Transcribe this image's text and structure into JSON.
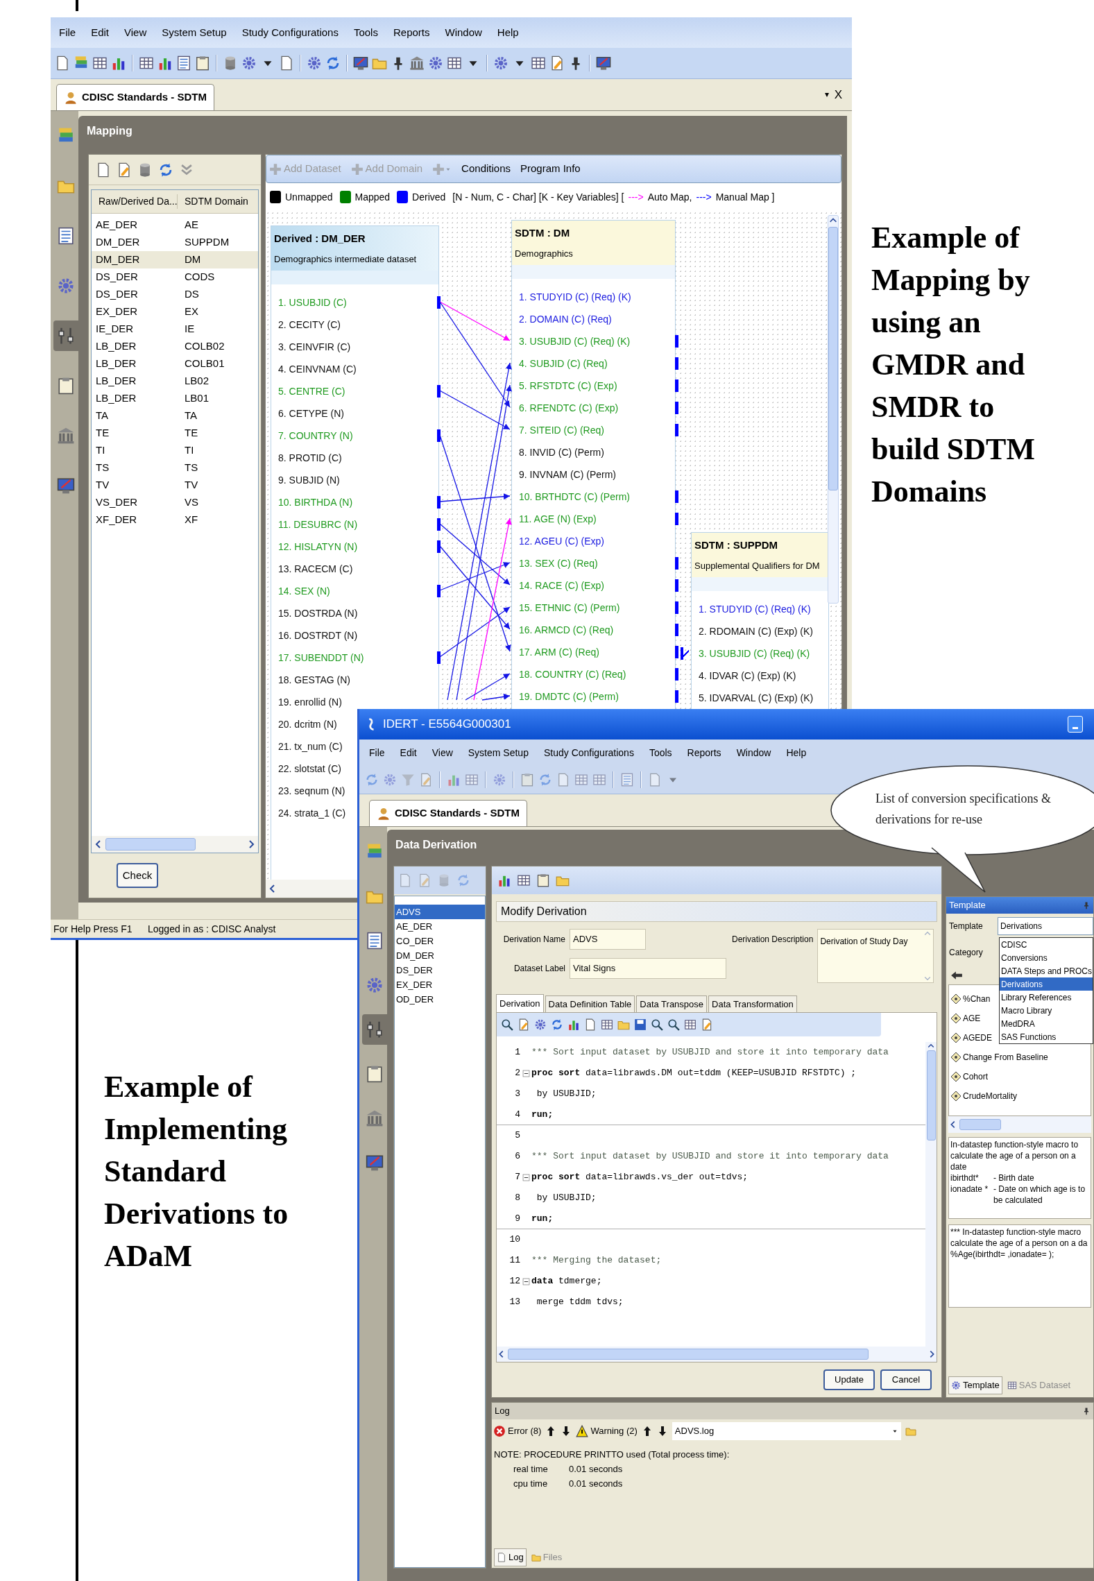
{
  "top_window": {
    "menu": [
      "File",
      "Edit",
      "View",
      "System Setup",
      "Study Configurations",
      "Tools",
      "Reports",
      "Window",
      "Help"
    ],
    "tab": {
      "label": "CDISC Standards - SDTM",
      "selected": true
    },
    "tab_controls": [
      {
        "kind": "menu",
        "label": "▾"
      },
      {
        "kind": "close",
        "label": "X"
      }
    ],
    "sidebar_items": [
      {
        "selected": false
      },
      {
        "selected": false
      },
      {
        "selected": false
      },
      {
        "selected": false
      },
      {
        "selected": true
      },
      {
        "selected": false
      },
      {
        "selected": false
      },
      {
        "selected": false
      }
    ],
    "panel_title": "Mapping",
    "dataset_table": {
      "columns": [
        "Raw/Derived Da...",
        "SDTM Domain"
      ],
      "rows": [
        {
          "dataset": "AE_DER",
          "domain": "AE",
          "selected": false
        },
        {
          "dataset": "DM_DER",
          "domain": "SUPPDM",
          "selected": false
        },
        {
          "dataset": "DM_DER",
          "domain": "DM",
          "selected": true
        },
        {
          "dataset": "DS_DER",
          "domain": "CODS",
          "selected": false
        },
        {
          "dataset": "DS_DER",
          "domain": "DS",
          "selected": false
        },
        {
          "dataset": "EX_DER",
          "domain": "EX",
          "selected": false
        },
        {
          "dataset": "IE_DER",
          "domain": "IE",
          "selected": false
        },
        {
          "dataset": "LB_DER",
          "domain": "COLB02",
          "selected": false
        },
        {
          "dataset": "LB_DER",
          "domain": "COLB01",
          "selected": false
        },
        {
          "dataset": "LB_DER",
          "domain": "LB02",
          "selected": false
        },
        {
          "dataset": "LB_DER",
          "domain": "LB01",
          "selected": false
        },
        {
          "dataset": "TA",
          "domain": "TA",
          "selected": false
        },
        {
          "dataset": "TE",
          "domain": "TE",
          "selected": false
        },
        {
          "dataset": "TI",
          "domain": "TI",
          "selected": false
        },
        {
          "dataset": "TS",
          "domain": "TS",
          "selected": false
        },
        {
          "dataset": "TV",
          "domain": "TV",
          "selected": false
        },
        {
          "dataset": "VS_DER",
          "domain": "VS",
          "selected": false
        },
        {
          "dataset": "XF_DER",
          "domain": "XF",
          "selected": false
        }
      ]
    },
    "check_button": "Check",
    "toolbar": [
      {
        "kind": "add",
        "label": "Add Dataset",
        "disabled": true
      },
      {
        "kind": "add",
        "label": "Add Domain",
        "disabled": true
      },
      {
        "kind": "add_menu",
        "disabled": true
      },
      {
        "kind": "text",
        "label": "Conditions",
        "disabled": false
      },
      {
        "kind": "text",
        "label": "Program Info",
        "disabled": false
      }
    ],
    "legend": [
      {
        "label": "Unmapped",
        "color": "#000000"
      },
      {
        "label": "Mapped",
        "color": "#008000"
      },
      {
        "label": "Derived",
        "color": "#0000ff"
      }
    ],
    "legend_note": "[N - Num, C - Char] [K - Key Variables] [",
    "map_types": [
      {
        "arrow": "--->",
        "label": "Auto Map,",
        "color": "#ff00ff"
      },
      {
        "arrow": "--->",
        "label": "Manual Map ]",
        "color": "#0000ff"
      }
    ],
    "datasets": [
      {
        "kind": "derived",
        "title": "Derived : DM_DER",
        "subtitle": "Demographics intermediate dataset",
        "variables": [
          {
            "label": "1. USUBJID (C)",
            "color": "#1f9a1f",
            "mapped": true
          },
          {
            "label": "2. CECITY (C)",
            "color": "#111111",
            "mapped": false
          },
          {
            "label": "3. CEINVFIR (C)",
            "color": "#111111",
            "mapped": false
          },
          {
            "label": "4. CEINVNAM (C)",
            "color": "#111111",
            "mapped": false
          },
          {
            "label": "5. CENTRE (C)",
            "color": "#1f9a1f",
            "mapped": true
          },
          {
            "label": "6. CETYPE (N)",
            "color": "#111111",
            "mapped": false
          },
          {
            "label": "7. COUNTRY (N)",
            "color": "#1f9a1f",
            "mapped": true
          },
          {
            "label": "8. PROTID (C)",
            "color": "#111111",
            "mapped": false
          },
          {
            "label": "9. SUBJID (N)",
            "color": "#111111",
            "mapped": false
          },
          {
            "label": "10. BIRTHDA (N)",
            "color": "#1f9a1f",
            "mapped": true
          },
          {
            "label": "11. DESUBRC (N)",
            "color": "#1f9a1f",
            "mapped": true
          },
          {
            "label": "12. HISLATYN (N)",
            "color": "#1f9a1f",
            "mapped": true
          },
          {
            "label": "13. RACECM (C)",
            "color": "#111111",
            "mapped": false
          },
          {
            "label": "14. SEX (N)",
            "color": "#1f9a1f",
            "mapped": true
          },
          {
            "label": "15. DOSTRDA (N)",
            "color": "#111111",
            "mapped": false
          },
          {
            "label": "16. DOSTRDT (N)",
            "color": "#111111",
            "mapped": false
          },
          {
            "label": "17. SUBENDDT (N)",
            "color": "#1f9a1f",
            "mapped": true
          },
          {
            "label": "18. GESTAG (N)",
            "color": "#111111",
            "mapped": false
          },
          {
            "label": "19. enrollid (N)",
            "color": "#111111",
            "mapped": false
          },
          {
            "label": "20. dcritm (N)",
            "color": "#111111",
            "mapped": false
          },
          {
            "label": "21. tx_num (C)",
            "color": "#111111",
            "mapped": false
          },
          {
            "label": "22. slotstat (C)",
            "color": "#111111",
            "mapped": false
          },
          {
            "label": "23. seqnum (N)",
            "color": "#111111",
            "mapped": false
          },
          {
            "label": "24. strata_1 (C)",
            "color": "#111111",
            "mapped": false
          }
        ]
      },
      {
        "kind": "sdtm",
        "title": "SDTM : DM",
        "subtitle": "Demographics",
        "variables": [
          {
            "label": "1. STUDYID (C) (Req) (K)",
            "color": "#1a1ae0",
            "mapped": false
          },
          {
            "label": "2. DOMAIN (C) (Req)",
            "color": "#1a1ae0",
            "mapped": false
          },
          {
            "label": "3. USUBJID (C) (Req) (K)",
            "color": "#1f9a1f",
            "mapped": true
          },
          {
            "label": "4. SUBJID (C) (Req)",
            "color": "#1f9a1f",
            "mapped": true
          },
          {
            "label": "5. RFSTDTC (C) (Exp)",
            "color": "#1f9a1f",
            "mapped": true
          },
          {
            "label": "6. RFENDTC (C) (Exp)",
            "color": "#1f9a1f",
            "mapped": true
          },
          {
            "label": "7. SITEID (C) (Req)",
            "color": "#1f9a1f",
            "mapped": true
          },
          {
            "label": "8. INVID (C) (Perm)",
            "color": "#111111",
            "mapped": false
          },
          {
            "label": "9. INVNAM (C) (Perm)",
            "color": "#111111",
            "mapped": false
          },
          {
            "label": "10. BRTHDTC (C) (Perm)",
            "color": "#1f9a1f",
            "mapped": true
          },
          {
            "label": "11. AGE (N) (Exp)",
            "color": "#1f9a1f",
            "mapped": true
          },
          {
            "label": "12. AGEU (C) (Exp)",
            "color": "#1a1ae0",
            "mapped": false
          },
          {
            "label": "13. SEX (C) (Req)",
            "color": "#1f9a1f",
            "mapped": true
          },
          {
            "label": "14. RACE (C) (Exp)",
            "color": "#1f9a1f",
            "mapped": true
          },
          {
            "label": "15. ETHNIC (C) (Perm)",
            "color": "#1f9a1f",
            "mapped": true
          },
          {
            "label": "16. ARMCD (C) (Req)",
            "color": "#1f9a1f",
            "mapped": true
          },
          {
            "label": "17. ARM (C) (Req)",
            "color": "#1f9a1f",
            "mapped": true
          },
          {
            "label": "18. COUNTRY (C) (Req)",
            "color": "#1f9a1f",
            "mapped": true
          },
          {
            "label": "19. DMDTC (C) (Perm)",
            "color": "#1f9a1f",
            "mapped": true
          }
        ]
      },
      {
        "kind": "sdtm_supp",
        "title": "SDTM : SUPPDM",
        "subtitle": "Supplemental Qualifiers for DM",
        "variables": [
          {
            "label": "1. STUDYID (C) (Req) (K)",
            "color": "#1a1ae0",
            "mapped": false
          },
          {
            "label": "2. RDOMAIN (C) (Exp) (K)",
            "color": "#111111",
            "mapped": false
          },
          {
            "label": "3. USUBJID (C) (Req) (K)",
            "color": "#1f9a1f",
            "mapped": true
          },
          {
            "label": "4. IDVAR (C) (Exp) (K)",
            "color": "#111111",
            "mapped": false
          },
          {
            "label": "5. IDVARVAL (C) (Exp) (K)",
            "color": "#111111",
            "mapped": false
          }
        ]
      }
    ],
    "status_bar": [
      "For Help Press F1",
      "Logged in as : CDISC Analyst"
    ]
  },
  "bottom_window": {
    "title": "IDERT - E5564G000301",
    "menu": [
      "File",
      "Edit",
      "View",
      "System Setup",
      "Study Configurations",
      "Tools",
      "Reports",
      "Window",
      "Help"
    ],
    "tab": {
      "label": "CDISC Standards - SDTM",
      "selected": true
    },
    "sidebar_items": [
      {
        "selected": false
      },
      {
        "selected": false
      },
      {
        "selected": false
      },
      {
        "selected": false
      },
      {
        "selected": true
      },
      {
        "selected": false
      },
      {
        "selected": false
      },
      {
        "selected": false
      }
    ],
    "panel_title": "Data Derivation",
    "callout": "List of conversion specifications & derivations for re-use",
    "derivations": [
      {
        "label": "ADVS",
        "selected": true
      },
      {
        "label": "AE_DER",
        "selected": false
      },
      {
        "label": "CO_DER",
        "selected": false
      },
      {
        "label": "DM_DER",
        "selected": false
      },
      {
        "label": "DS_DER",
        "selected": false
      },
      {
        "label": "EX_DER",
        "selected": false
      },
      {
        "label": "OD_DER",
        "selected": false
      }
    ],
    "form_title": "Modify Derivation",
    "fields": [
      {
        "label": "Derivation Name",
        "value": "ADVS"
      },
      {
        "label": "Dataset Label",
        "value": "Vital Signs"
      }
    ],
    "description": {
      "label": "Derivation Description",
      "value": "Derivation of Study Day"
    },
    "editor_tabs": [
      {
        "label": "Derivation",
        "selected": true
      },
      {
        "label": "Data Definition Table",
        "selected": false
      },
      {
        "label": "Data Transpose",
        "selected": false
      },
      {
        "label": "Data Transformation",
        "selected": false
      }
    ],
    "code_lines": [
      {
        "num": "1",
        "kind": "comment",
        "fold": false,
        "text": "*** Sort input dataset by USUBJID and store it into temporary data"
      },
      {
        "num": "2",
        "kind": "code",
        "fold": true,
        "text": "**proc sort** data=librawds.DM out=tddm (KEEP=USUBJID RFSTDTC) ;"
      },
      {
        "num": "3",
        "kind": "code",
        "fold": false,
        "text": " by USUBJID;"
      },
      {
        "num": "4",
        "kind": "block_end",
        "fold": false,
        "text": "run;"
      },
      {
        "num": "5",
        "kind": "blank",
        "fold": false
      },
      {
        "num": "6",
        "kind": "comment",
        "fold": false,
        "text": "*** Sort input dataset by USUBJID and store it into temporary data"
      },
      {
        "num": "7",
        "kind": "code",
        "fold": true,
        "text": "**proc sort** data=librawds.vs_der out=tdvs;"
      },
      {
        "num": "8",
        "kind": "code",
        "fold": false,
        "text": " by USUBJID;"
      },
      {
        "num": "9",
        "kind": "block_end",
        "fold": false,
        "text": "run;"
      },
      {
        "num": "10",
        "kind": "blank",
        "fold": false
      },
      {
        "num": "11",
        "kind": "comment",
        "fold": false,
        "text": "*** Merging the dataset;"
      },
      {
        "num": "12",
        "kind": "code",
        "fold": true,
        "text": "**data** tdmerge;"
      },
      {
        "num": "13",
        "kind": "code",
        "fold": false,
        "text": " merge tddm tdvs;"
      }
    ],
    "buttons": [
      "Update",
      "Cancel"
    ],
    "template_panel": {
      "title": "Template",
      "template_label": "Template",
      "template_value": "Derivations",
      "category_label": "Category",
      "categories": [
        {
          "label": "CDISC",
          "selected": false
        },
        {
          "label": "Conversions",
          "selected": false
        },
        {
          "label": "DATA Steps and PROCs",
          "selected": false
        },
        {
          "label": "Derivations",
          "selected": true
        },
        {
          "label": "Library References",
          "selected": false
        },
        {
          "label": "Macro Library",
          "selected": false
        },
        {
          "label": "MedDRA",
          "selected": false
        },
        {
          "label": "SAS Functions",
          "selected": false
        }
      ],
      "items": [
        "%Chan",
        "AGE",
        "AGEDE",
        "Change From Baseline",
        "Cohort",
        "CrudeMortality"
      ],
      "description": "In-datastep function-style macro to calculate the age of a person on a date",
      "params": [
        {
          "name": "ibirthdt*",
          "text": "- Birth date"
        },
        {
          "name": "ionadate *",
          "text": "- Date on which age is to be calculated"
        }
      ],
      "code": [
        "*** In-datastep function-style macro",
        "calculate the age of a person on a da",
        "%Age(ibirthdt= ,ionadate= );"
      ],
      "tabs": [
        {
          "label": "Template",
          "selected": true
        },
        {
          "label": "SAS Dataset",
          "selected": false
        }
      ]
    },
    "log": {
      "title": "Log",
      "filters": [
        {
          "kind": "error",
          "label": "Error (8)"
        },
        {
          "kind": "warning",
          "label": "Warning (2)"
        }
      ],
      "file": "ADVS.log",
      "note": "NOTE: PROCEDURE PRINTTO used (Total process time):",
      "times": [
        {
          "label": "real time",
          "value": "0.01 seconds"
        },
        {
          "label": "cpu time",
          "value": "0.01 seconds"
        }
      ],
      "tabs": [
        {
          "kind": "log",
          "label": "Log",
          "selected": true
        },
        {
          "kind": "files",
          "label": "Files",
          "selected": false
        }
      ]
    }
  },
  "captions": [
    "Example of Mapping by using an GMDR and SMDR to build SDTM Domains",
    "Example of Implementing Standard Derivations to ADaM"
  ]
}
